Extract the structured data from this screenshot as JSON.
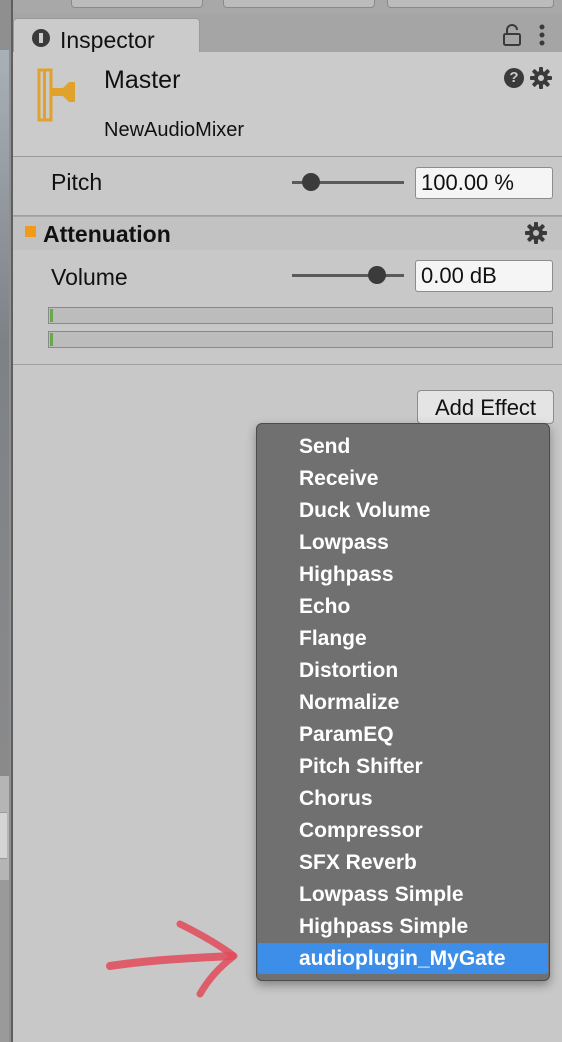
{
  "inspector": {
    "tab_title": "Inspector"
  },
  "header": {
    "title": "Master",
    "subtitle": "NewAudioMixer"
  },
  "pitch": {
    "label": "Pitch",
    "value": "100.00 %",
    "slider_fraction": 0.17
  },
  "attenuation": {
    "title": "Attenuation",
    "volume_label": "Volume",
    "volume_value": "0.00 dB",
    "volume_slider_fraction": 0.76
  },
  "add_effect": {
    "label": "Add Effect"
  },
  "effect_menu": {
    "items": [
      "Send",
      "Receive",
      "Duck Volume",
      "Lowpass",
      "Highpass",
      "Echo",
      "Flange",
      "Distortion",
      "Normalize",
      "ParamEQ",
      "Pitch Shifter",
      "Chorus",
      "Compressor",
      "SFX Reverb",
      "Lowpass Simple",
      "Highpass Simple",
      "audioplugin_MyGate"
    ],
    "selected_index": 16
  },
  "colors": {
    "section_marker": "#f29a1b",
    "menu_background": "#707070",
    "menu_selection": "#3d8ee8",
    "annotation_arrow": "#e24a5a",
    "mixer_icon": "#e0a22b",
    "meter_fill": "#6aa84f"
  },
  "icons": {
    "tab": "info-icon",
    "lock": "lock-icon",
    "menu": "kebab-icon",
    "mixer": "audio-mixer-icon",
    "help": "help-icon",
    "settings": "gear-icon",
    "annotation": "arrow-icon"
  }
}
